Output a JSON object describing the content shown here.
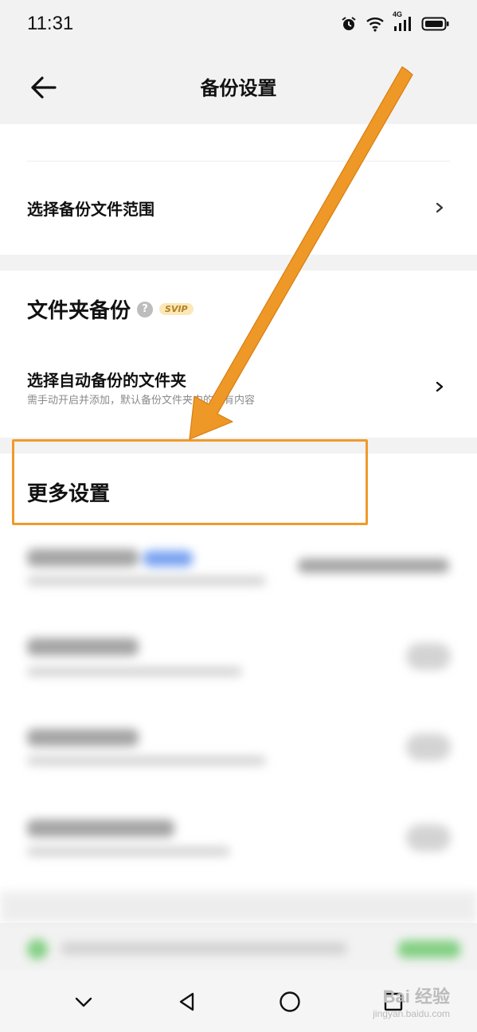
{
  "status_bar": {
    "time": "11:31",
    "icons": [
      "alarm-icon",
      "wifi-icon",
      "signal-4g-icon",
      "battery-icon"
    ],
    "network_label": "4G"
  },
  "header": {
    "title": "备份设置",
    "back_icon": "arrow-left-icon"
  },
  "top_section": {
    "items": [
      {
        "label": "选择备份文件范围",
        "icon": "chevron-right-icon"
      }
    ]
  },
  "folder_backup": {
    "title": "文件夹备份",
    "help_icon": "question-icon",
    "help_glyph": "?",
    "badge": "SVIP",
    "items": [
      {
        "label": "选择自动备份的文件夹",
        "sublabel": "需手动开启并添加，默认备份文件夹内的所有内容",
        "icon": "chevron-right-icon"
      }
    ]
  },
  "more_settings": {
    "title": "更多设置"
  },
  "annotation": {
    "color": "#f09a2a"
  },
  "watermark": {
    "main": "Bai 经验",
    "sub": "jingyan.baidu.com"
  },
  "colors": {
    "background": "#f2f2f2",
    "card": "#ffffff",
    "svip_bg": "#fbe7b8",
    "svip_text": "#b5821f",
    "highlight": "#f09a2a"
  }
}
